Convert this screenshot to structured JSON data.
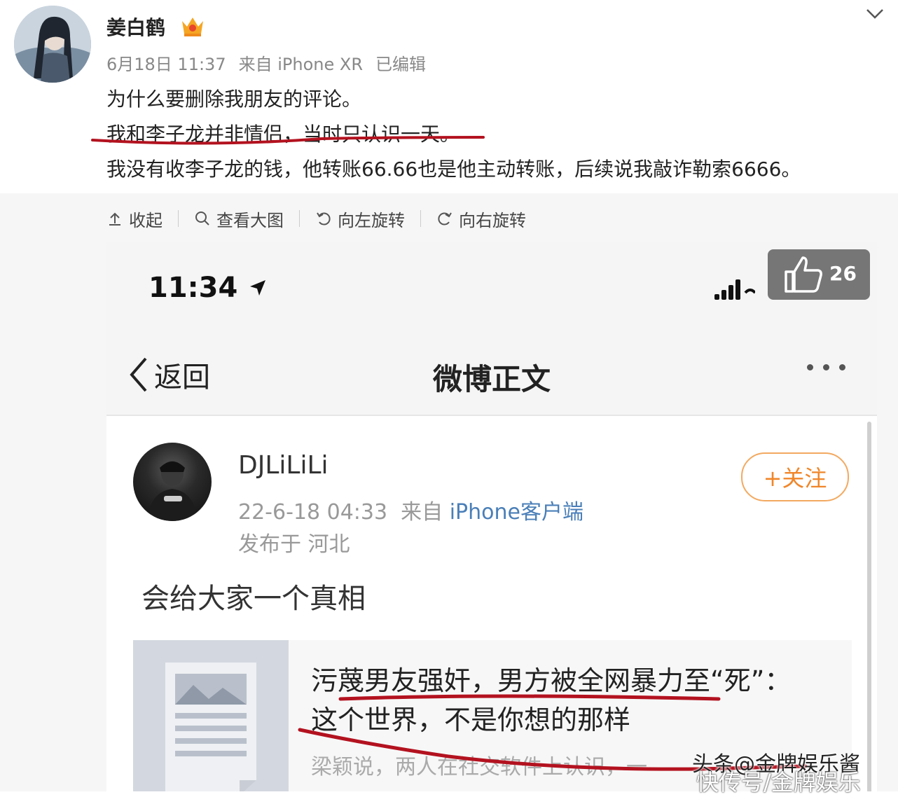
{
  "post": {
    "username": "姜白鹤",
    "date": "6月18日 11:37",
    "source": "来自 iPhone XR",
    "edited": "已编辑",
    "lines": [
      "为什么要删除我朋友的评论。",
      "我和李子龙并非情侣，当时只认识一天。",
      "我没有收李子龙的钱，他转账66.66也是他主动转账，后续说我敲诈勒索6666。"
    ]
  },
  "toolbar": {
    "collapse": "收起",
    "view_large": "查看大图",
    "rotate_left": "向左旋转",
    "rotate_right": "向右旋转"
  },
  "screenshot": {
    "status_time": "11:34",
    "like_count": "26",
    "back_label": "返回",
    "page_title": "微博正文",
    "author": {
      "name": "DJLiLiLi",
      "datetime": "22-6-18 04:33",
      "source_prefix": "来自",
      "source_client": "iPhone客户端",
      "location": "发布于 河北",
      "follow_label": "+关注"
    },
    "post_text": "会给大家一个真相",
    "link_card": {
      "title": "污蔑男友强奸，男方被全网暴力至“死”：这个世界，不是你想的那样",
      "desc": "梁颖说，两人在社交软件上认识，一"
    }
  },
  "watermark": {
    "line1": "头条@金牌娱乐酱",
    "line2": "快传号/金牌娱乐"
  },
  "colors": {
    "annotation_red": "#b3121f",
    "follow_orange": "#f0862a",
    "link_blue": "#4a7fb8"
  }
}
